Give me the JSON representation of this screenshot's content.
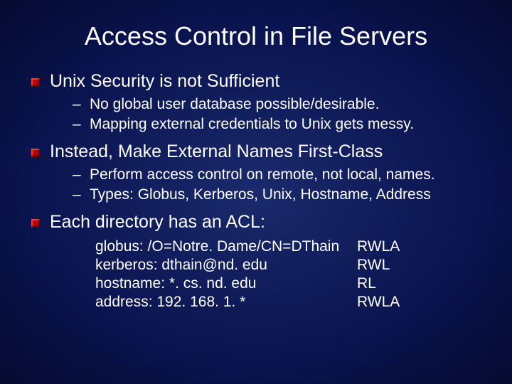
{
  "title": "Access Control in File Servers",
  "bullets": [
    {
      "text": "Unix Security is not Sufficient",
      "sub": [
        "No global user database possible/desirable.",
        "Mapping external credentials to Unix gets messy."
      ]
    },
    {
      "text": "Instead, Make External Names First-Class",
      "sub": [
        "Perform access control on remote, not local, names.",
        "Types: Globus, Kerberos, Unix, Hostname, Address"
      ]
    },
    {
      "text": "Each directory has an ACL:",
      "acl": [
        {
          "name": "globus: /O=Notre. Dame/CN=DThain",
          "perm": "RWLA"
        },
        {
          "name": "kerberos: dthain@nd. edu",
          "perm": "RWL"
        },
        {
          "name": "hostname: *. cs. nd. edu",
          "perm": "RL"
        },
        {
          "name": "address: 192. 168. 1. *",
          "perm": "RWLA"
        }
      ]
    }
  ]
}
